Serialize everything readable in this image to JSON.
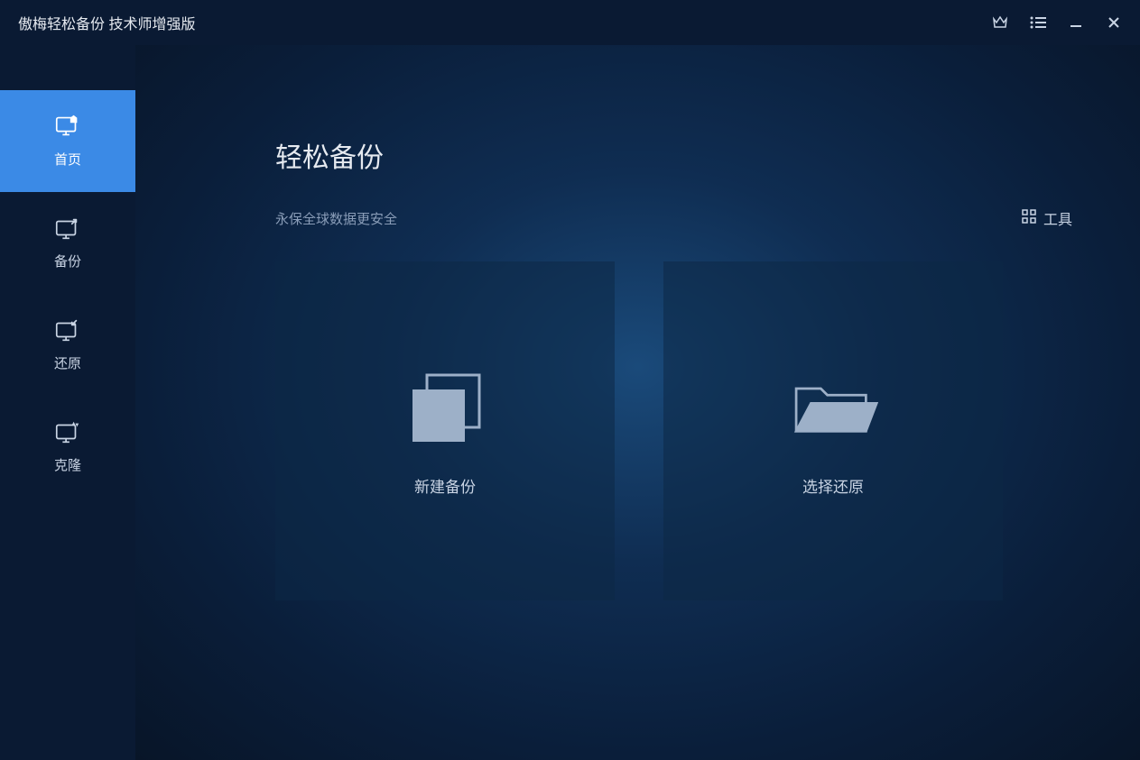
{
  "titlebar": {
    "app_name": "傲梅轻松备份 技术师增强版"
  },
  "sidebar": {
    "items": [
      {
        "label": "首页"
      },
      {
        "label": "备份"
      },
      {
        "label": "还原"
      },
      {
        "label": "克隆"
      }
    ]
  },
  "main": {
    "title": "轻松备份",
    "subtitle": "永保全球数据更安全",
    "tools_label": "工具",
    "cards": [
      {
        "label": "新建备份"
      },
      {
        "label": "选择还原"
      }
    ]
  }
}
